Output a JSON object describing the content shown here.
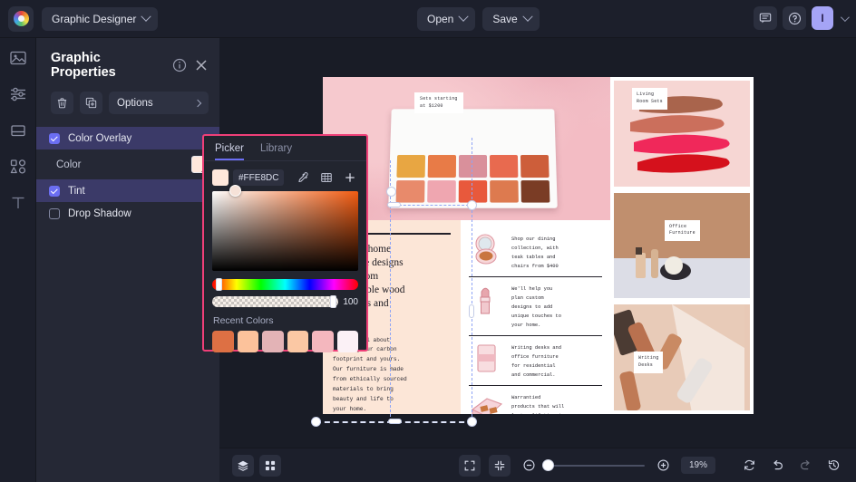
{
  "app": {
    "logo_icon": "color-wheel-logo",
    "document_name": "Graphic Designer"
  },
  "topbar": {
    "open_label": "Open",
    "save_label": "Save",
    "comment_icon": "comment-icon",
    "help_icon": "help-circle-icon",
    "avatar_initial": "I"
  },
  "rail": {
    "items": [
      {
        "icon": "image-icon",
        "name": "sidebar-item-image"
      },
      {
        "icon": "sliders-icon",
        "name": "sidebar-item-adjustments"
      },
      {
        "icon": "layout-icon",
        "name": "sidebar-item-layout"
      },
      {
        "icon": "shapes-icon",
        "name": "sidebar-item-shapes"
      },
      {
        "icon": "text-icon",
        "name": "sidebar-item-text"
      }
    ]
  },
  "panel": {
    "title": "Graphic Properties",
    "info_icon": "info-circle-icon",
    "close_icon": "close-icon",
    "delete_icon": "trash-icon",
    "duplicate_icon": "duplicate-icon",
    "options_label": "Options",
    "layers": [
      {
        "label": "Color Overlay",
        "checked": true,
        "expanded": true,
        "active": true
      },
      {
        "label": "Tint",
        "checked": true,
        "expanded": false,
        "active": true
      },
      {
        "label": "Drop Shadow",
        "checked": false,
        "expanded": false,
        "active": false
      }
    ],
    "color_sub_label": "Color",
    "color_swatch_value": "#FFE8DC"
  },
  "picker": {
    "tabs": [
      {
        "label": "Picker",
        "active": true
      },
      {
        "label": "Library",
        "active": false
      }
    ],
    "hex": "#FFE8DC",
    "eyedropper_icon": "eyedropper-icon",
    "grid_icon": "grid-icon",
    "add_icon": "plus-icon",
    "alpha_value": "100",
    "recent_label": "Recent Colors",
    "recent_colors": [
      "#DD7044",
      "#FCC29B",
      "#E3B3B6",
      "#FBC8A4",
      "#F4B7BE",
      "#FBF1F6"
    ],
    "accent_border": "#EF3F78",
    "tab_underline": "#6B6EF2"
  },
  "canvas": {
    "hero": {
      "tag_text": "Sets starting\nat $1200",
      "swatches": [
        "#E8A642",
        "#E87B47",
        "#D9909B",
        "#E86A4F",
        "#CD5E3A",
        "#E88A6B",
        "#EFA6B0",
        "#E8593C",
        "#DD7A4F",
        "#7A3C25"
      ]
    },
    "text_column": {
      "heading": "Custom home\nfurniture designs\nmade from\nsustainable wood\nmaterials and\nfinishes",
      "body": "We care all about\nreducing our carbon\nfootprint and yours.\nOur furniture is made\nfrom ethically sourced\nmaterials to bring\nbeauty and life to\nyour home."
    },
    "list_items": [
      {
        "thumb": "compact-powder",
        "text": "Shop our dining\ncollection, with\nteak tables and\nchairs from $400"
      },
      {
        "thumb": "lipstick",
        "text": "We'll help you\nplan custom\ndesigns to add\nunique touches to\nyour home."
      },
      {
        "thumb": "blush-box",
        "text": "Writing desks and\noffice furniture\nfor residential\nand commercial."
      },
      {
        "thumb": "duo-palette",
        "text": "Warrantied\nproducts that will\nlast a lifetime in\nyour home."
      }
    ],
    "photo_cards": [
      {
        "tag": "Living\nRoom Sets",
        "bg": "#F6D6D3"
      },
      {
        "tag": "Office\nFurniture",
        "bg": "#C08F6E"
      },
      {
        "tag": "Writing\nDesks",
        "bg": "#E8C9B6"
      }
    ]
  },
  "bottombar": {
    "layers_icon": "layers-icon",
    "grid_icon": "grid-view-icon",
    "fit_icon": "fit-screen-icon",
    "shrink_icon": "shrink-icon",
    "zoom_out_icon": "zoom-out-icon",
    "zoom_in_icon": "zoom-in-icon",
    "zoom_level": "19%",
    "refresh_icon": "refresh-icon",
    "undo_icon": "undo-icon",
    "redo_icon": "redo-icon",
    "history_icon": "history-icon"
  }
}
